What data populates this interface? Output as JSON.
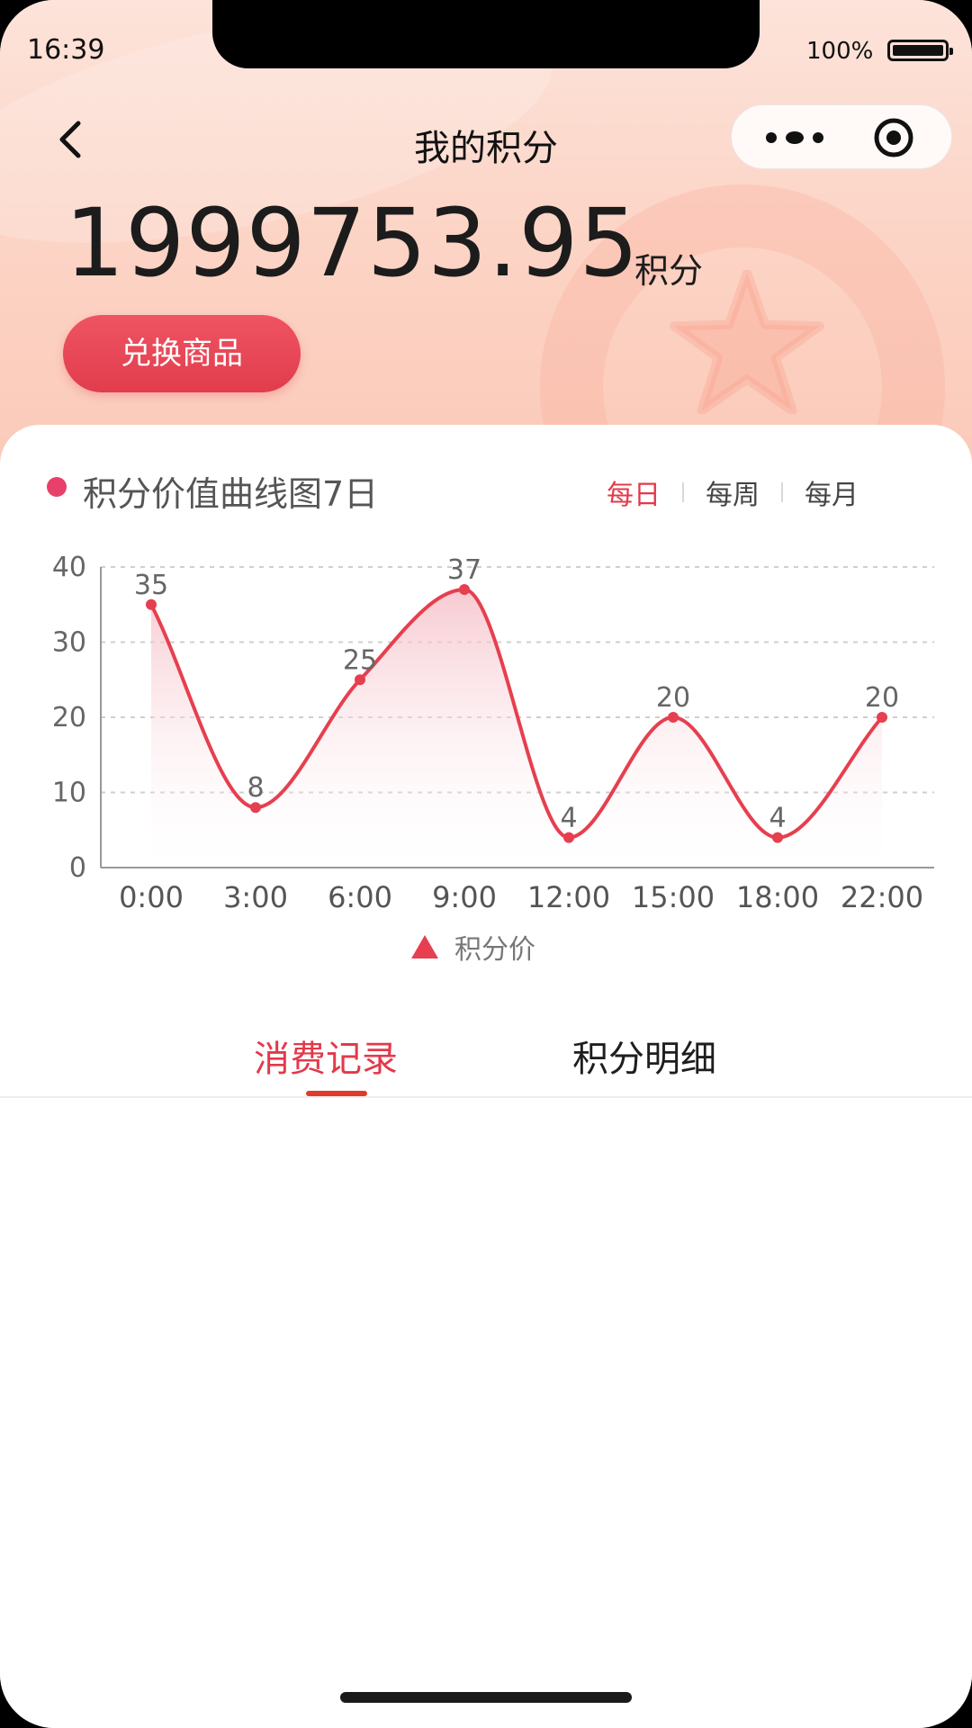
{
  "status_bar": {
    "time": "16:39",
    "battery": "100%"
  },
  "nav": {
    "title": "我的积分",
    "back_icon": "chevron-left-icon",
    "more_icon": "more-dots-icon",
    "close_icon": "target-circle-icon"
  },
  "points": {
    "value": "1999753.95",
    "unit": "积分",
    "exchange_button": "兑换商品"
  },
  "chart_header": {
    "title": "积分价值曲线图7日",
    "periods": [
      "每日",
      "每周",
      "每月"
    ],
    "active_period": "每日"
  },
  "chart_data": {
    "type": "line",
    "smooth": true,
    "area_fill": true,
    "categories": [
      "0:00",
      "3:00",
      "6:00",
      "9:00",
      "12:00",
      "15:00",
      "18:00",
      "22:00"
    ],
    "series": [
      {
        "name": "积分价",
        "values": [
          35,
          8,
          25,
          37,
          4,
          20,
          4,
          20
        ]
      }
    ],
    "y_ticks": [
      "0",
      "10",
      "20",
      "30",
      "40"
    ],
    "ylim": [
      0,
      40
    ],
    "grid": "horizontal-dashed",
    "data_labels": [
      "35",
      "8",
      "25",
      "37",
      "4",
      "20",
      "4",
      "20"
    ],
    "legend_position": "bottom-center",
    "colors": {
      "line": "#e63f4f",
      "fill_top": "#f7c6cc",
      "fill_bottom": "#ffffff"
    }
  },
  "record_tabs": {
    "items": [
      "消费记录",
      "积分明细"
    ],
    "active": "消费记录"
  },
  "colors": {
    "accent": "#e3394a",
    "header_bg": "#fcd6c8",
    "button": "#e6434f"
  }
}
